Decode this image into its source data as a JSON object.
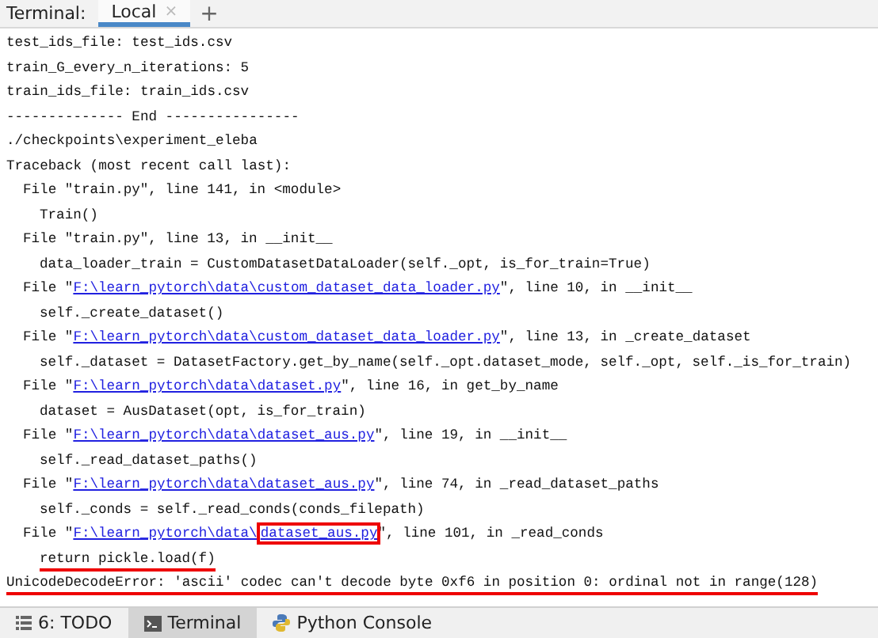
{
  "top_bar": {
    "label": "Terminal:",
    "tabs": [
      {
        "label": "Local",
        "selected": true,
        "close": "×"
      }
    ],
    "add_button": "+"
  },
  "lines": [
    {
      "kind": "text",
      "text": "test_ids_file: test_ids.csv"
    },
    {
      "kind": "text",
      "text": "train_G_every_n_iterations: 5"
    },
    {
      "kind": "text",
      "text": "train_ids_file: train_ids.csv"
    },
    {
      "kind": "text",
      "text": "-------------- End ----------------"
    },
    {
      "kind": "text",
      "text": "./checkpoints\\experiment_eleba"
    },
    {
      "kind": "text",
      "text": "Traceback (most recent call last):"
    },
    {
      "kind": "frame",
      "text": "File \"train.py\", line 141, in <module>"
    },
    {
      "kind": "code",
      "text": "Train()",
      "underlined": false
    },
    {
      "kind": "frame",
      "text": "File \"train.py\", line 13, in __init__"
    },
    {
      "kind": "code",
      "text": "data_loader_train = CustomDatasetDataLoader(self._opt, is_for_train=True)",
      "underlined": false
    },
    {
      "kind": "file",
      "before": "File \"",
      "link": "F:\\learn_pytorch\\data\\custom_dataset_data_loader.py",
      "after": "\", line 10, in __init__"
    },
    {
      "kind": "code",
      "text": "self._create_dataset()",
      "underlined": false
    },
    {
      "kind": "file",
      "before": "File \"",
      "link": "F:\\learn_pytorch\\data\\custom_dataset_data_loader.py",
      "after": "\", line 13, in _create_dataset"
    },
    {
      "kind": "code",
      "text": "self._dataset = DatasetFactory.get_by_name(self._opt.dataset_mode, self._opt, self._is_for_train)",
      "underlined": false
    },
    {
      "kind": "file",
      "before": "File \"",
      "link": "F:\\learn_pytorch\\data\\dataset.py",
      "after": "\", line 16, in get_by_name"
    },
    {
      "kind": "code",
      "text": "dataset = AusDataset(opt, is_for_train)",
      "underlined": false
    },
    {
      "kind": "file",
      "before": "File \"",
      "link": "F:\\learn_pytorch\\data\\dataset_aus.py",
      "after": "\", line 19, in __init__"
    },
    {
      "kind": "code",
      "text": "self._read_dataset_paths()",
      "underlined": false
    },
    {
      "kind": "file",
      "before": "File \"",
      "link": "F:\\learn_pytorch\\data\\dataset_aus.py",
      "after": "\", line 74, in _read_dataset_paths"
    },
    {
      "kind": "code",
      "text": "self._conds = self._read_conds(conds_filepath)",
      "underlined": false
    },
    {
      "kind": "file",
      "before": "File \"",
      "link": "F:\\learn_pytorch\\data\\",
      "link_boxed": "dataset_aus.py",
      "after": "\", line 101, in _read_conds"
    },
    {
      "kind": "code",
      "text": "return pickle.load(f)",
      "underlined": true
    },
    {
      "kind": "error",
      "error_type": "UnicodeDecodeError",
      "type_underlined": true,
      "message": ": 'ascii' codec can't decode byte 0xf6 in position 0: ordinal not in range(128)",
      "message_underlined": true
    }
  ],
  "bottom_bar": [
    {
      "label": "6: TODO",
      "selected": false
    },
    {
      "label": "Terminal",
      "selected": true
    },
    {
      "label": "Python Console",
      "selected": false
    }
  ]
}
